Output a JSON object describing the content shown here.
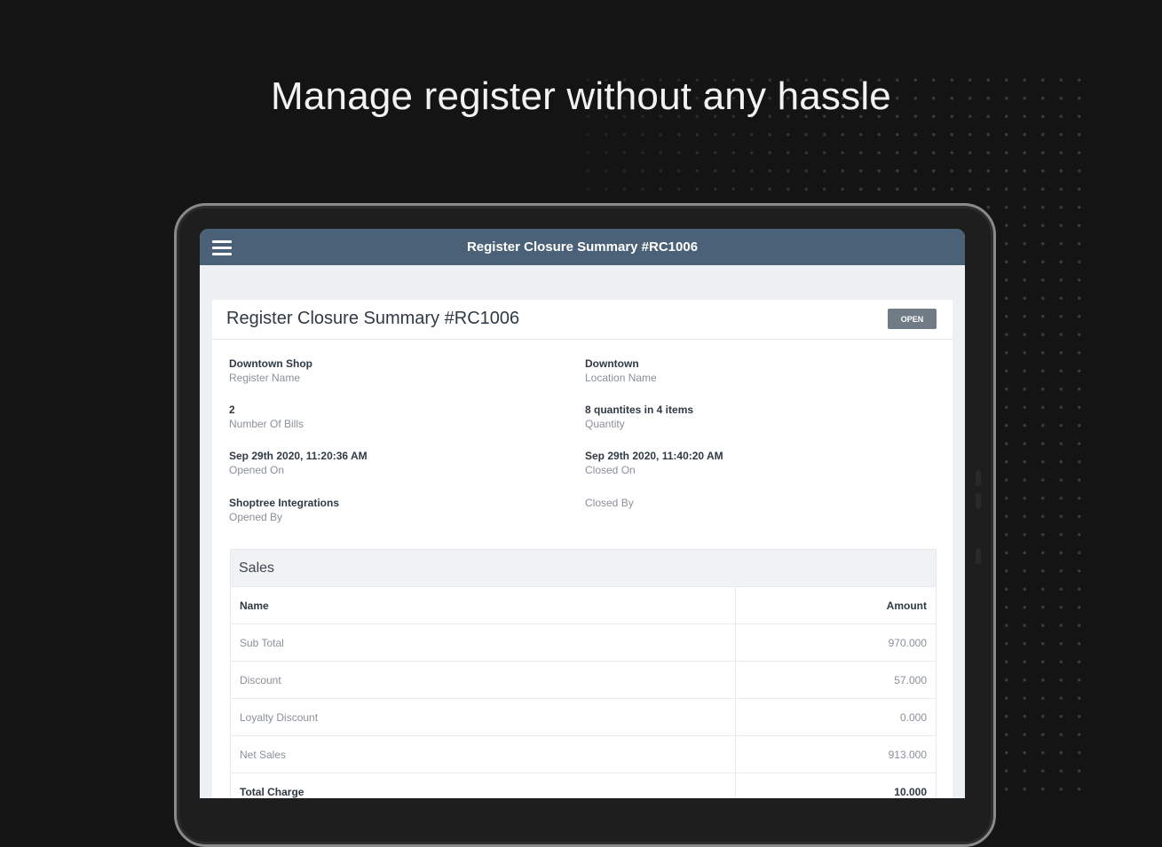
{
  "headline": "Manage register without any hassle",
  "appbar": {
    "title": "Register Closure Summary #RC1006"
  },
  "card": {
    "title": "Register Closure Summary #RC1006",
    "status": "OPEN"
  },
  "fields": {
    "register_name": {
      "value": "Downtown Shop",
      "label": "Register Name"
    },
    "location_name": {
      "value": "Downtown",
      "label": "Location Name"
    },
    "number_of_bills": {
      "value": "2",
      "label": "Number Of Bills"
    },
    "quantity": {
      "value": "8 quantites in 4 items",
      "label": "Quantity"
    },
    "opened_on": {
      "value": "Sep 29th 2020, 11:20:36 AM",
      "label": "Opened On"
    },
    "closed_on": {
      "value": "Sep 29th 2020, 11:40:20 AM",
      "label": "Closed On"
    },
    "opened_by": {
      "value": "Shoptree Integrations",
      "label": "Opened By"
    },
    "closed_by": {
      "value": "",
      "label": "Closed By"
    }
  },
  "sales": {
    "title": "Sales",
    "columns": [
      "Name",
      "Amount"
    ],
    "rows": [
      {
        "name": "Sub Total",
        "amount": "970.000"
      },
      {
        "name": "Discount",
        "amount": "57.000"
      },
      {
        "name": "Loyalty Discount",
        "amount": "0.000"
      },
      {
        "name": "Net Sales",
        "amount": "913.000"
      },
      {
        "name": "Total Charge",
        "amount": "10.000"
      }
    ]
  },
  "colors": {
    "background": "#141414",
    "appbar": "#4b6178",
    "badge": "#707b85"
  }
}
